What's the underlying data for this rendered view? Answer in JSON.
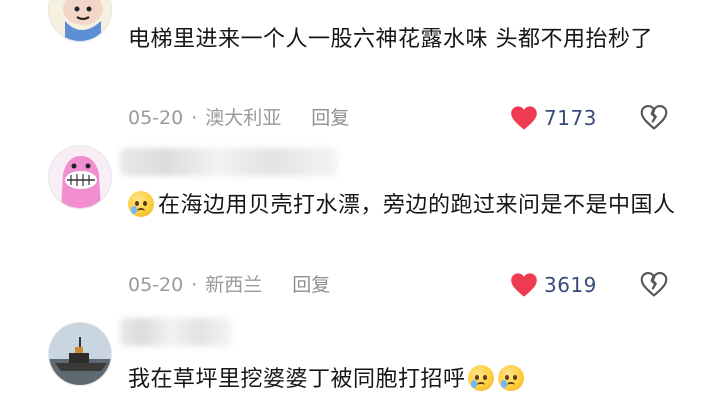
{
  "comments": [
    {
      "text": "电梯里进来一个人一股六神花露水味 头都不用抬秒了",
      "date": "05-20",
      "location": "澳大利亚",
      "reply_label": "回复",
      "likes": "7173",
      "avatar_icon": "cartoon-avatar-icon"
    },
    {
      "text": "在海边用贝壳打水漂，旁边的跑过来问是不是中国人",
      "date": "05-20",
      "location": "新西兰",
      "reply_label": "回复",
      "likes": "3619",
      "avatar_icon": "pink-monster-avatar-icon",
      "emoji": "tearful-emoji"
    },
    {
      "text": "我在草坪里挖婆婆丁被同胞打招呼",
      "avatar_icon": "ship-photo-avatar-icon",
      "emoji": "crying-laughing-emoji"
    }
  ],
  "separator": "·",
  "colors": {
    "heart": "#ee3b50",
    "like_count": "#3a4a7a",
    "meta": "#9a9a9a",
    "text": "#161616"
  }
}
